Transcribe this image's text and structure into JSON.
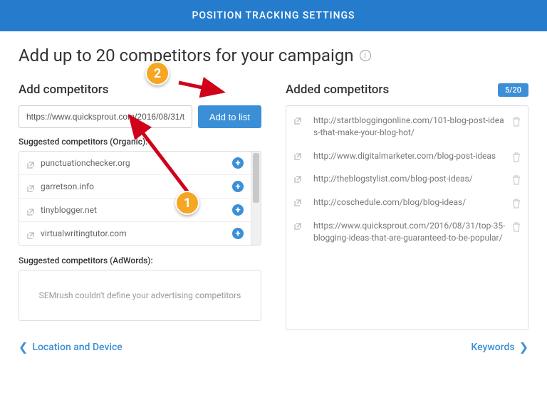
{
  "header": {
    "title": "POSITION TRACKING SETTINGS"
  },
  "page": {
    "title": "Add up to 20 competitors for your campaign"
  },
  "left": {
    "section_title": "Add competitors",
    "input_value": "https://www.quicksprout.com/2016/08/31/t",
    "add_button": "Add to list",
    "organic_title": "Suggested competitors (Organic):",
    "organic": [
      "punctuationchecker.org",
      "garretson.info",
      "tinyblogger.net",
      "virtualwritingtutor.com"
    ],
    "adwords_title": "Suggested competitors (AdWords):",
    "adwords_empty": "SEMrush couldn't define your advertising competitors"
  },
  "right": {
    "section_title": "Added competitors",
    "counter": "5/20",
    "items": [
      "http://startbloggingonline.com/101-blog-post-ideas-that-make-your-blog-hot/",
      "http://www.digitalmarketer.com/blog-post-ideas",
      "http://theblogstylist.com/blog-post-ideas/",
      "http://coschedule.com/blog/blog-ideas/",
      "https://www.quicksprout.com/2016/08/31/top-35-blogging-ideas-that-are-guaranteed-to-be-popular/"
    ]
  },
  "footer": {
    "back": "Location and Device",
    "next": "Keywords"
  },
  "annotations": {
    "step1": "1",
    "step2": "2"
  }
}
